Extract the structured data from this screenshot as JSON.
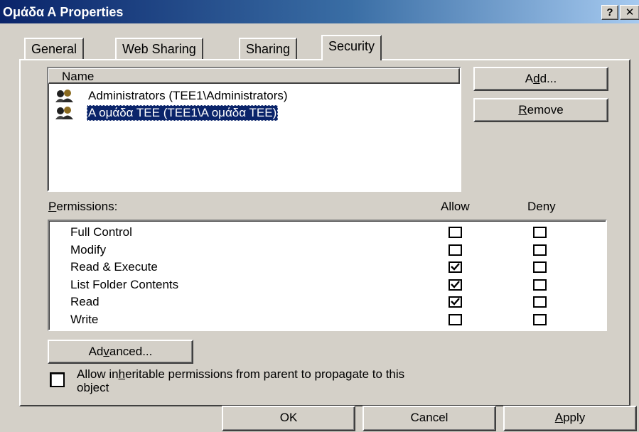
{
  "window": {
    "title": "Ομάδα Α Properties",
    "help_label": "?",
    "close_label": "✕"
  },
  "tabs": [
    {
      "label": "General"
    },
    {
      "label": "Web Sharing"
    },
    {
      "label": "Sharing"
    },
    {
      "label": "Security",
      "active": true
    }
  ],
  "users": {
    "column_header": "Name",
    "items": [
      {
        "label": "Administrators (TEE1\\Administrators)",
        "selected": false,
        "icon": "group-icon"
      },
      {
        "label": "Α ομάδα ΤΕΕ (TEE1\\Α ομάδα ΤΕΕ)",
        "selected": true,
        "icon": "group-icon"
      }
    ]
  },
  "buttons": {
    "add": {
      "before": "A",
      "accel": "d",
      "after": "d..."
    },
    "remove": {
      "before": "",
      "accel": "R",
      "after": "emove"
    },
    "advanced": {
      "before": "Ad",
      "accel": "v",
      "after": "anced..."
    },
    "ok": "OK",
    "cancel": "Cancel",
    "apply": {
      "before": "",
      "accel": "A",
      "after": "pply"
    }
  },
  "permissions": {
    "label_accel": "P",
    "label_rest": "ermissions:",
    "allow_header": "Allow",
    "deny_header": "Deny",
    "rows": [
      {
        "name": "Full Control",
        "allow": false,
        "deny": false
      },
      {
        "name": "Modify",
        "allow": false,
        "deny": false
      },
      {
        "name": "Read & Execute",
        "allow": true,
        "deny": false
      },
      {
        "name": "List Folder Contents",
        "allow": true,
        "deny": false
      },
      {
        "name": "Read",
        "allow": true,
        "deny": false
      },
      {
        "name": "Write",
        "allow": false,
        "deny": false
      }
    ]
  },
  "inherit": {
    "checked": false,
    "line1_before": "Allow in",
    "line1_accel": "h",
    "line1_after": "eritable permissions from parent to propagate to this",
    "line2": "object"
  },
  "colors": {
    "face": "#d4d0c8",
    "title_active": "#0a246a",
    "selection": "#0a246a"
  }
}
